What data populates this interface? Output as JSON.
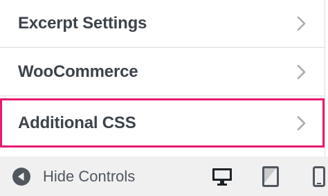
{
  "menu": {
    "items": [
      {
        "label": "Excerpt Settings"
      },
      {
        "label": "WooCommerce"
      },
      {
        "label": "Additional CSS"
      }
    ]
  },
  "footer": {
    "hide_controls_label": "Hide Controls",
    "devices": [
      "desktop-icon",
      "tablet-icon",
      "mobile-icon"
    ]
  },
  "colors": {
    "highlight_border": "#e8196f",
    "text": "#3c434a",
    "footer_bg": "#f0f0f1"
  }
}
